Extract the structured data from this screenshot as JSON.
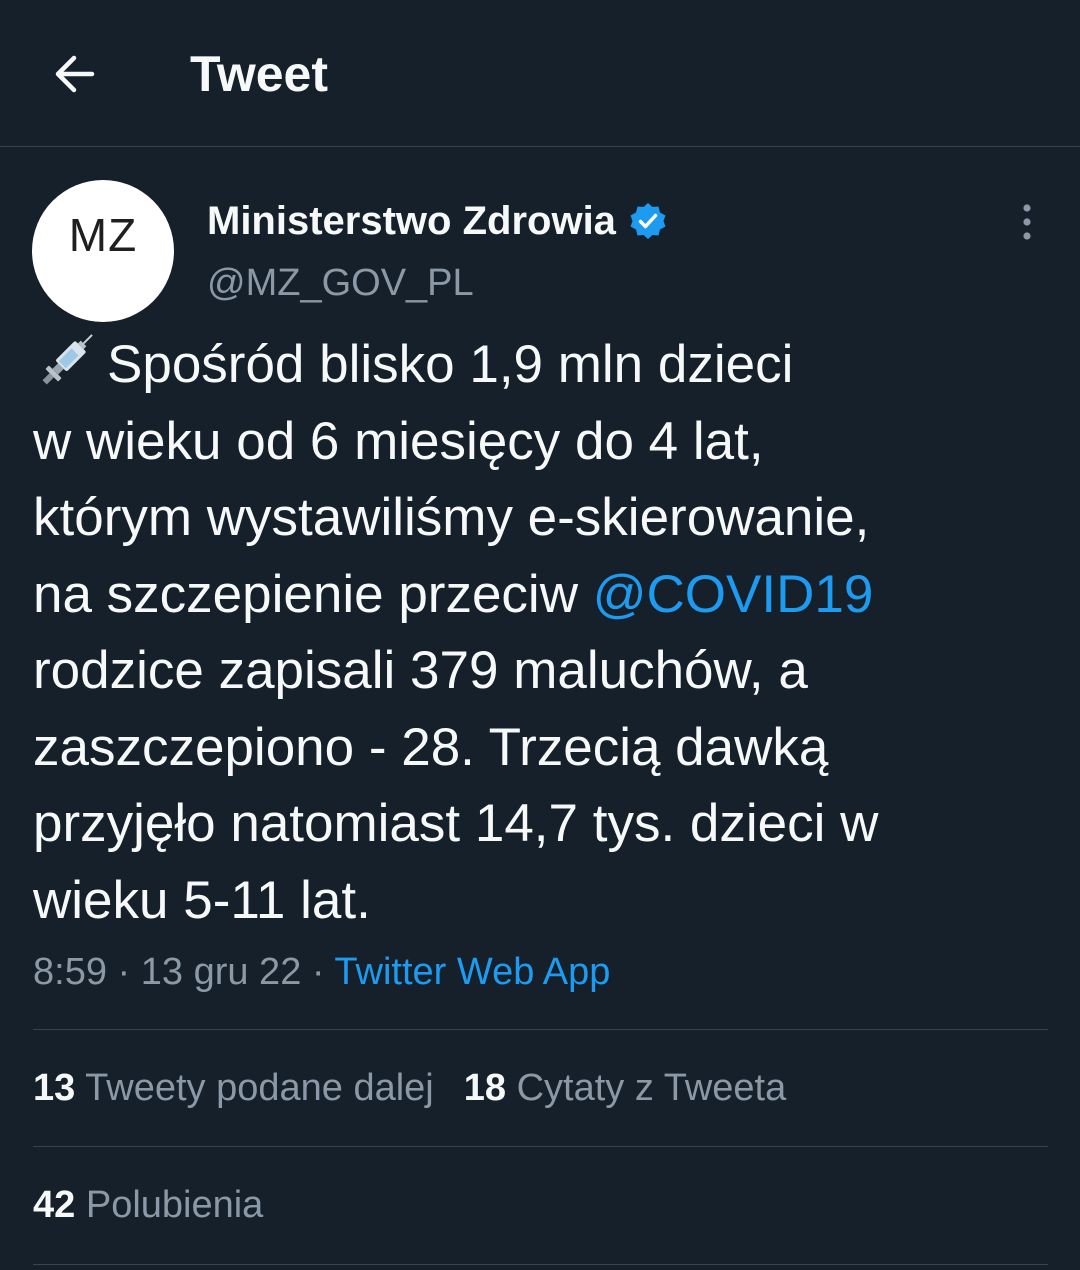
{
  "header": {
    "title": "Tweet",
    "back_icon": "arrow-left-icon"
  },
  "author": {
    "avatar_text": "MZ",
    "display_name": "Ministerstwo Zdrowia",
    "handle": "@MZ_GOV_PL",
    "verified_icon": "verified-badge-icon",
    "more_icon": "more-vertical-icon"
  },
  "tweet": {
    "emoji_icon": "syringe-icon",
    "lines": [
      "Spośród blisko 1,9 mln dzieci",
      "w wieku od 6 miesięcy do 4 lat,",
      "którym wystawiliśmy e-skierowanie,",
      "na szczepienie przeciw ",
      "rodzice zapisali 379 maluchów, a",
      "zaszczepiono - 28. Trzecią dawką",
      "przyjęło natomiast 14,7 tys. dzieci w",
      "wieku 5-11 lat."
    ],
    "mention": "@COVID19"
  },
  "meta": {
    "time": "8:59",
    "separator": " · ",
    "date": "13 gru 22",
    "source": "Twitter Web App"
  },
  "stats": {
    "retweets_count": "13",
    "retweets_label": "Tweety podane dalej",
    "quotes_count": "18",
    "quotes_label": "Cytaty z Tweeta",
    "likes_count": "42",
    "likes_label": "Polubienia"
  },
  "colors": {
    "background": "#15202b",
    "accent": "#1d9bf0",
    "secondary_text": "#8b98a5",
    "divider": "#38444d"
  }
}
